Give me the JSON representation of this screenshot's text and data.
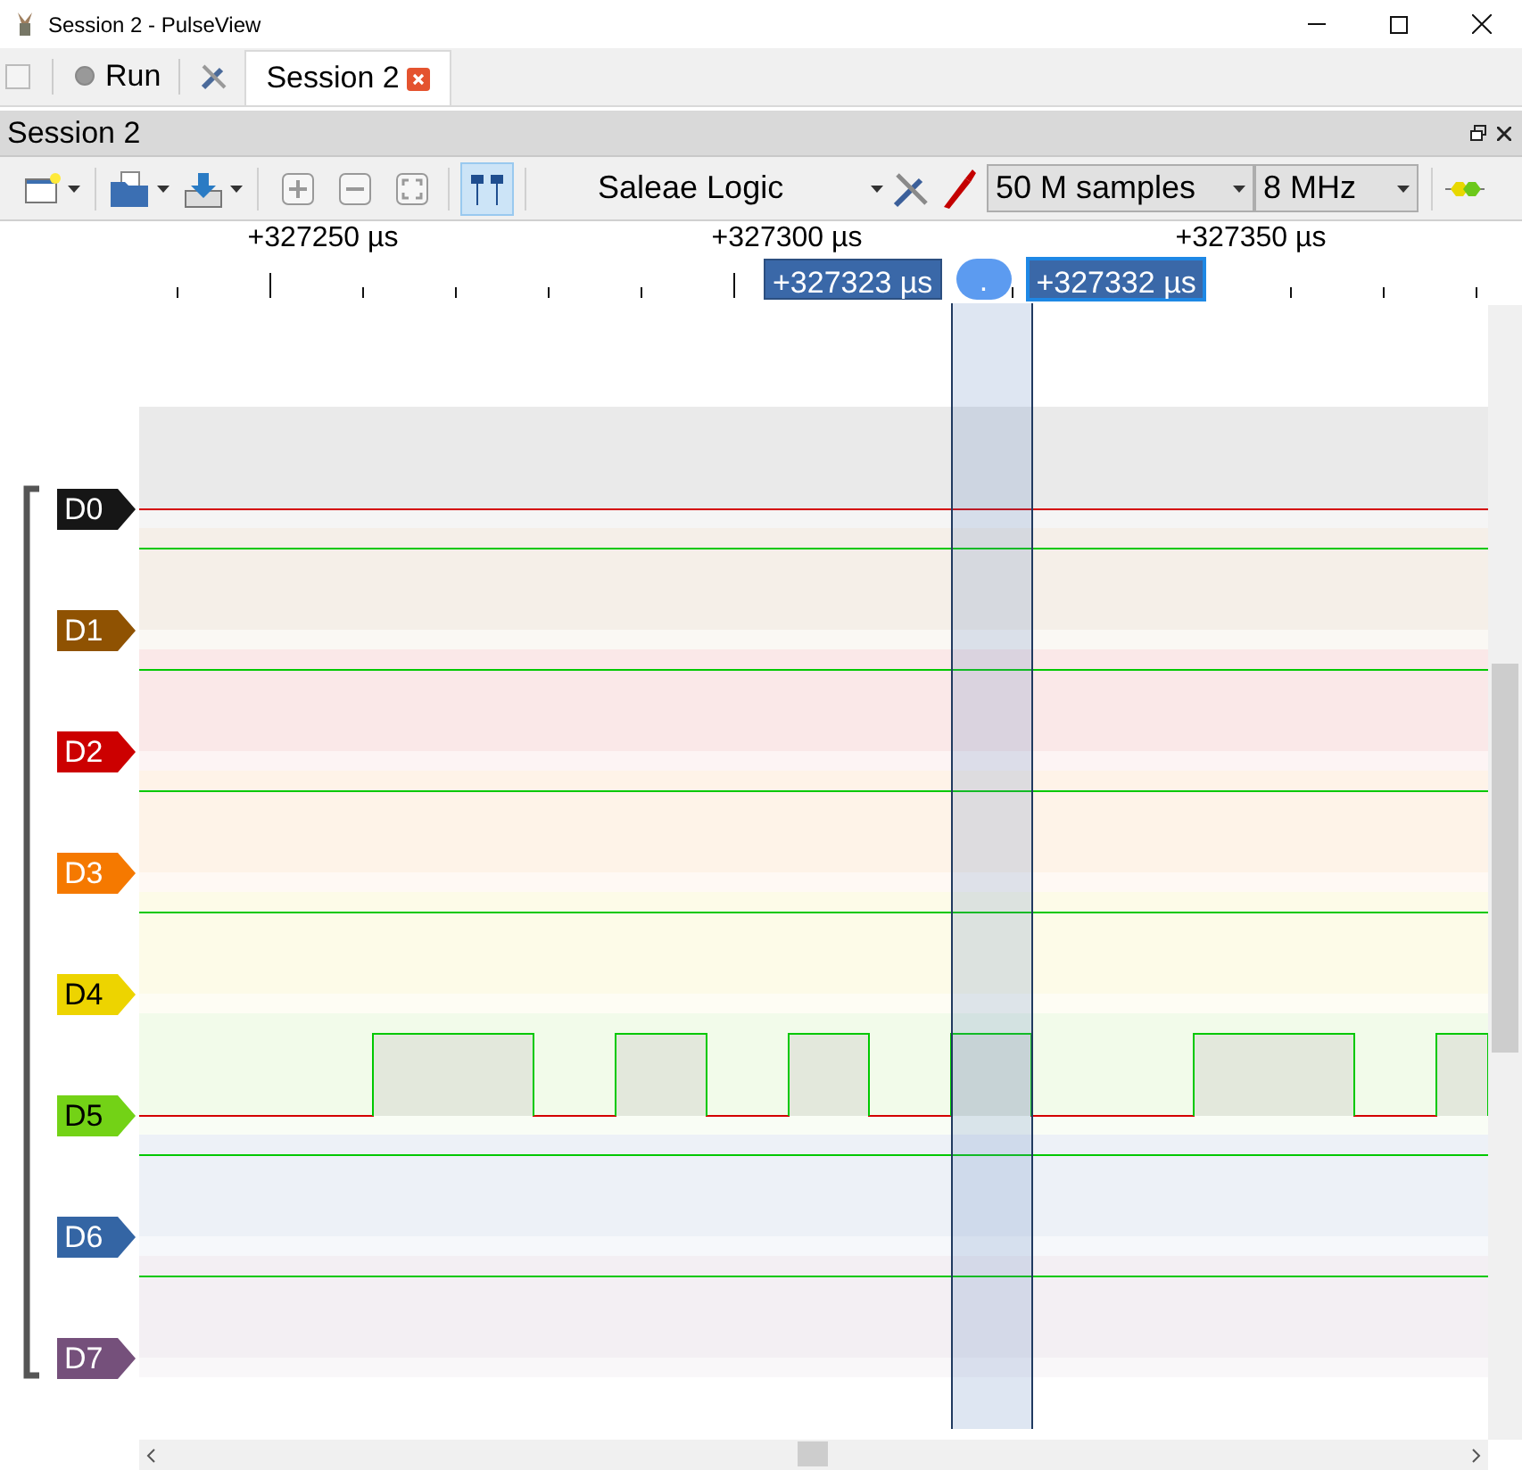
{
  "window": {
    "title": "Session 2 - PulseView"
  },
  "main_toolbar": {
    "run_label": "Run",
    "tab": {
      "label": "Session 2",
      "selected": true
    }
  },
  "session": {
    "title": "Session 2"
  },
  "toolbar": {
    "device": "Saleae Logic",
    "sample_count": "50 M samples",
    "sample_rate": "8 MHz",
    "cursors_on": true
  },
  "ruler": {
    "labels": [
      "+327250 µs",
      "+327300 µs",
      "+327350 µs"
    ]
  },
  "cursors": {
    "start": "+327323 µs",
    "handle": ".",
    "end": "+327332 µs"
  },
  "channels": [
    {
      "name": "D0",
      "color": "#161616",
      "kind": "low"
    },
    {
      "name": "D1",
      "color": "#8f5202",
      "kind": "high"
    },
    {
      "name": "D2",
      "color": "#cc0000",
      "kind": "high"
    },
    {
      "name": "D3",
      "color": "#f57900",
      "kind": "high"
    },
    {
      "name": "D4",
      "color": "#edd400",
      "kind": "high"
    },
    {
      "name": "D5",
      "color": "#73d216",
      "kind": "toggling"
    },
    {
      "name": "D6",
      "color": "#3465a4",
      "kind": "high"
    },
    {
      "name": "D7",
      "color": "#75507b",
      "kind": "high"
    }
  ]
}
